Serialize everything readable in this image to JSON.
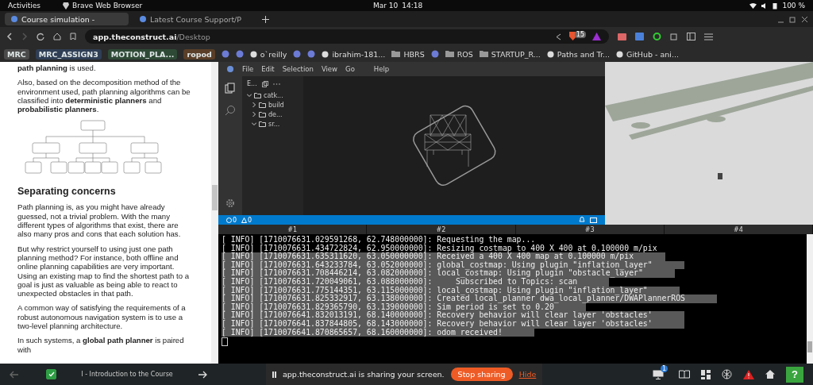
{
  "system_bar": {
    "activities": "Activities",
    "app": "Brave Web Browser",
    "date": "Mar 10",
    "time": "14:18",
    "battery": "100 %"
  },
  "tabs": [
    {
      "label": "Course simulation -",
      "selected": true
    },
    {
      "label": "Latest Course Support/P",
      "selected": false
    }
  ],
  "address": {
    "domain": "app.theconstruct.ai",
    "path": "/Desktop",
    "shields_badge": "15"
  },
  "bookmarks": [
    {
      "kind": "tag",
      "label": "MRC",
      "color": "#4a4a4a"
    },
    {
      "kind": "tag",
      "label": "MRC_ASSIGN3",
      "color": "#2f3e55"
    },
    {
      "kind": "tag",
      "label": "MOTION_PLA...",
      "color": "#2e4a36"
    },
    {
      "kind": "tag",
      "label": "ropod",
      "color": "#5a3e28"
    },
    {
      "kind": "icon"
    },
    {
      "kind": "icon"
    },
    {
      "kind": "site",
      "label": "o`reilly"
    },
    {
      "kind": "icon"
    },
    {
      "kind": "icon"
    },
    {
      "kind": "site",
      "label": "ibrahim-181..."
    },
    {
      "kind": "folder",
      "label": "HBRS"
    },
    {
      "kind": "icon"
    },
    {
      "kind": "folder",
      "label": "ROS"
    },
    {
      "kind": "folder",
      "label": "STARTUP_R..."
    },
    {
      "kind": "site",
      "label": "Paths and Tr..."
    },
    {
      "kind": "site",
      "label": "GitHub - ani..."
    }
  ],
  "lesson": {
    "paragraphs_top": [
      "**path planning** is used.",
      "Also, based on the decomposition method of the environment used, path planning algorithms can be classified into **deterministic planners** and **probabilistic planners**."
    ],
    "heading": "Separating concerns",
    "paragraphs": [
      "Path planning is, as you might have already guessed, not a trivial problem. With the many different types of algorithms that exist, there are also many pros and cons that each solution has.",
      "But why restrict yourself to using just one path planning method? For instance, both offline and online planning capabilities are very important. Using an existing map to find the shortest path to a goal is just as valuable as being able to react to unexpected obstacles in that path.",
      "A common way of satisfying the requirements of a robust autonomous navigation system is to use a two-level planning architecture.",
      "In such systems, a **global path planner** is paired with"
    ]
  },
  "ide": {
    "menu": [
      "File",
      "Edit",
      "Selection",
      "View",
      "Go",
      "Help"
    ],
    "explorer_title": "E...",
    "tree": [
      {
        "label": "catk...",
        "expanded": true,
        "children": [
          {
            "label": "build",
            "expanded": false
          },
          {
            "label": "de...",
            "expanded": false
          },
          {
            "label": "sr...",
            "expanded": true
          }
        ]
      }
    ],
    "errors": "0",
    "warnings": "0"
  },
  "terminal": {
    "tabs": [
      "#1",
      "#2",
      "#3",
      "#4"
    ],
    "lines": [
      {
        "text": "[ INFO] [1710076631.029591268, 62.748000000]: Requesting the map...",
        "selected": false
      },
      {
        "text": "[ INFO] [1710076631.434722824, 62.950000000]: Resizing costmap to 400 X 400 at 0.100000 m/pix",
        "selected": false
      },
      {
        "text": "[ INFO] [1710076631.635311620, 63.050000000]: Received a 400 X 400 map at 0.100000 m/pix",
        "selected": true
      },
      {
        "text": "[ INFO] [1710076631.643233784, 63.052000000]: global_costmap: Using plugin \"inflation_layer\"",
        "selected": true
      },
      {
        "text": "[ INFO] [1710076631.708446214, 63.082000000]: local_costmap: Using plugin \"obstacle_layer\"",
        "selected": true
      },
      {
        "text": "[ INFO] [1710076631.720049061, 63.088000000]:     Subscribed to Topics: scan",
        "selected": true
      },
      {
        "text": "[ INFO] [1710076631.775144351, 63.115000000]: local_costmap: Using plugin \"inflation_layer\"",
        "selected": true
      },
      {
        "text": "[ INFO] [1710076631.825332917, 63.138000000]: Created local_planner dwa_local_planner/DWAPlannerROS",
        "selected": true
      },
      {
        "text": "[ INFO] [1710076631.829365790, 63.139000000]: Sim period is set to 0.20",
        "selected": true
      },
      {
        "text": "[ INFO] [1710076641.832013191, 68.140000000]: Recovery behavior will clear layer 'obstacles'",
        "selected": true
      },
      {
        "text": "[ INFO] [1710076641.837844805, 68.143000000]: Recovery behavior will clear layer 'obstacles'",
        "selected": true
      },
      {
        "text": "[ INFO] [1710076641.870865657, 68.160000000]: odom received!",
        "selected": true
      }
    ]
  },
  "bottom_bar": {
    "unit_done": true,
    "unit": "I - Introduction to the Course",
    "notice": "app.theconstruct.ai is sharing your screen.",
    "stop": "Stop sharing",
    "hide": "Hide",
    "monitor_badge": "1",
    "help": "?"
  }
}
